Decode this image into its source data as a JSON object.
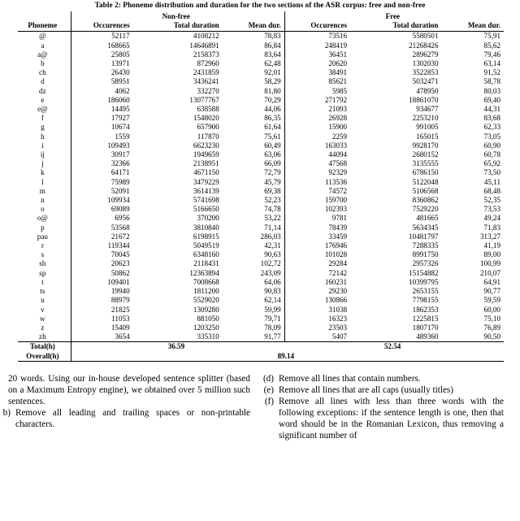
{
  "caption": "Table 2: Phoneme distribution and duration for the two sections of the ASR corpus: free and non-free",
  "table": {
    "group_headers": {
      "left": "Non-free",
      "right": "Free"
    },
    "columns": {
      "phoneme": "Phoneme",
      "occurences_nonfree": "Occurences",
      "total_duration_nonfree": "Total duration",
      "mean_dur_nonfree": "Mean dur.",
      "occurences_free": "Occurences",
      "total_duration_free": "Total duration",
      "mean_dur_free": "Mean dur."
    },
    "rows": [
      {
        "phoneme": "@",
        "nf_occ": "52117",
        "nf_tot": "4108212",
        "nf_mean": "78,83",
        "f_occ": "73516",
        "f_tot": "5580501",
        "f_mean": "75,91"
      },
      {
        "phoneme": "a",
        "nf_occ": "168665",
        "nf_tot": "14646891",
        "nf_mean": "86,84",
        "f_occ": "248419",
        "f_tot": "21268426",
        "f_mean": "85,62"
      },
      {
        "phoneme": "a@",
        "nf_occ": "25805",
        "nf_tot": "2158373",
        "nf_mean": "83,64",
        "f_occ": "36451",
        "f_tot": "2896279",
        "f_mean": "79,46"
      },
      {
        "phoneme": "b",
        "nf_occ": "13971",
        "nf_tot": "872960",
        "nf_mean": "62,48",
        "f_occ": "20620",
        "f_tot": "1302030",
        "f_mean": "63,14"
      },
      {
        "phoneme": "ch",
        "nf_occ": "26430",
        "nf_tot": "2431859",
        "nf_mean": "92,01",
        "f_occ": "38491",
        "f_tot": "3522853",
        "f_mean": "91,52"
      },
      {
        "phoneme": "d",
        "nf_occ": "58951",
        "nf_tot": "3436241",
        "nf_mean": "58,29",
        "f_occ": "85621",
        "f_tot": "5032471",
        "f_mean": "58,78"
      },
      {
        "phoneme": "dz",
        "nf_occ": "4062",
        "nf_tot": "332270",
        "nf_mean": "81,80",
        "f_occ": "5985",
        "f_tot": "478950",
        "f_mean": "80,03"
      },
      {
        "phoneme": "e",
        "nf_occ": "186060",
        "nf_tot": "13077767",
        "nf_mean": "70,29",
        "f_occ": "271792",
        "f_tot": "18861070",
        "f_mean": "69,40"
      },
      {
        "phoneme": "e@",
        "nf_occ": "14495",
        "nf_tot": "638588",
        "nf_mean": "44,06",
        "f_occ": "21093",
        "f_tot": "934677",
        "f_mean": "44,31"
      },
      {
        "phoneme": "f",
        "nf_occ": "17927",
        "nf_tot": "1548020",
        "nf_mean": "86,35",
        "f_occ": "26928",
        "f_tot": "2253210",
        "f_mean": "83,68"
      },
      {
        "phoneme": "g",
        "nf_occ": "10674",
        "nf_tot": "657900",
        "nf_mean": "61,64",
        "f_occ": "15900",
        "f_tot": "991005",
        "f_mean": "62,33"
      },
      {
        "phoneme": "h",
        "nf_occ": "1559",
        "nf_tot": "117870",
        "nf_mean": "75,61",
        "f_occ": "2259",
        "f_tot": "165015",
        "f_mean": "73,05"
      },
      {
        "phoneme": "i",
        "nf_occ": "109493",
        "nf_tot": "6623230",
        "nf_mean": "60,49",
        "f_occ": "163033",
        "f_tot": "9928170",
        "f_mean": "60,90"
      },
      {
        "phoneme": "ij",
        "nf_occ": "30917",
        "nf_tot": "1949659",
        "nf_mean": "63,06",
        "f_occ": "44094",
        "f_tot": "2680152",
        "f_mean": "60,78"
      },
      {
        "phoneme": "j",
        "nf_occ": "32366",
        "nf_tot": "2138951",
        "nf_mean": "66,09",
        "f_occ": "47568",
        "f_tot": "3135555",
        "f_mean": "65,92"
      },
      {
        "phoneme": "k",
        "nf_occ": "64171",
        "nf_tot": "4671150",
        "nf_mean": "72,79",
        "f_occ": "92329",
        "f_tot": "6786150",
        "f_mean": "73,50"
      },
      {
        "phoneme": "l",
        "nf_occ": "75989",
        "nf_tot": "3479229",
        "nf_mean": "45,79",
        "f_occ": "113536",
        "f_tot": "5122048",
        "f_mean": "45,11"
      },
      {
        "phoneme": "m",
        "nf_occ": "52091",
        "nf_tot": "3614139",
        "nf_mean": "69,38",
        "f_occ": "74572",
        "f_tot": "5106568",
        "f_mean": "68,48"
      },
      {
        "phoneme": "n",
        "nf_occ": "109934",
        "nf_tot": "5741698",
        "nf_mean": "52,23",
        "f_occ": "159700",
        "f_tot": "8360862",
        "f_mean": "52,35"
      },
      {
        "phoneme": "o",
        "nf_occ": "69089",
        "nf_tot": "5166650",
        "nf_mean": "74,78",
        "f_occ": "102393",
        "f_tot": "7529220",
        "f_mean": "73,53"
      },
      {
        "phoneme": "o@",
        "nf_occ": "6956",
        "nf_tot": "370200",
        "nf_mean": "53,22",
        "f_occ": "9781",
        "f_tot": "481665",
        "f_mean": "49,24"
      },
      {
        "phoneme": "p",
        "nf_occ": "53568",
        "nf_tot": "3810840",
        "nf_mean": "71,14",
        "f_occ": "78439",
        "f_tot": "5634345",
        "f_mean": "71,83"
      },
      {
        "phoneme": "pau",
        "nf_occ": "21672",
        "nf_tot": "6198915",
        "nf_mean": "286,03",
        "f_occ": "33459",
        "f_tot": "10481797",
        "f_mean": "313,27"
      },
      {
        "phoneme": "r",
        "nf_occ": "119344",
        "nf_tot": "5049519",
        "nf_mean": "42,31",
        "f_occ": "176946",
        "f_tot": "7288335",
        "f_mean": "41,19"
      },
      {
        "phoneme": "s",
        "nf_occ": "70045",
        "nf_tot": "6348160",
        "nf_mean": "90,63",
        "f_occ": "101028",
        "f_tot": "8991750",
        "f_mean": "89,00"
      },
      {
        "phoneme": "sh",
        "nf_occ": "20623",
        "nf_tot": "2118431",
        "nf_mean": "102,72",
        "f_occ": "29284",
        "f_tot": "2957326",
        "f_mean": "100,99"
      },
      {
        "phoneme": "sp",
        "nf_occ": "50862",
        "nf_tot": "12363894",
        "nf_mean": "243,09",
        "f_occ": "72142",
        "f_tot": "15154882",
        "f_mean": "210,07"
      },
      {
        "phoneme": "t",
        "nf_occ": "109401",
        "nf_tot": "7008668",
        "nf_mean": "64,06",
        "f_occ": "160231",
        "f_tot": "10399795",
        "f_mean": "64,91"
      },
      {
        "phoneme": "ts",
        "nf_occ": "19940",
        "nf_tot": "1811200",
        "nf_mean": "90,83",
        "f_occ": "29230",
        "f_tot": "2653155",
        "f_mean": "90,77"
      },
      {
        "phoneme": "u",
        "nf_occ": "88979",
        "nf_tot": "5529020",
        "nf_mean": "62,14",
        "f_occ": "130866",
        "f_tot": "7798155",
        "f_mean": "59,59"
      },
      {
        "phoneme": "v",
        "nf_occ": "21825",
        "nf_tot": "1309280",
        "nf_mean": "59,99",
        "f_occ": "31038",
        "f_tot": "1862353",
        "f_mean": "60,00"
      },
      {
        "phoneme": "w",
        "nf_occ": "11053",
        "nf_tot": "881050",
        "nf_mean": "79,71",
        "f_occ": "16323",
        "f_tot": "1225815",
        "f_mean": "75,10"
      },
      {
        "phoneme": "z",
        "nf_occ": "15409",
        "nf_tot": "1203250",
        "nf_mean": "78,09",
        "f_occ": "23503",
        "f_tot": "1807170",
        "f_mean": "76,89"
      },
      {
        "phoneme": "zh",
        "nf_occ": "3654",
        "nf_tot": "335310",
        "nf_mean": "91,77",
        "f_occ": "5407",
        "f_tot": "489360",
        "f_mean": "90,50"
      }
    ],
    "total": {
      "label": "Total(h)",
      "nonfree": "36.59",
      "free": "52.54"
    },
    "overall": {
      "label": "Overall(h)",
      "value": "89.14"
    }
  },
  "body": {
    "left": {
      "para": "20 words. Using our in-house developed sentence splitter (based on a Maximum Entropy engine), we obtained over 5 million such sentences.",
      "item_b": {
        "marker": "b)",
        "text": "Remove all leading and trailing spaces or non-printable characters."
      }
    },
    "right": {
      "item_d": {
        "marker": "(d)",
        "text": "Remove all lines that contain numbers."
      },
      "item_e": {
        "marker": "(e)",
        "text": "Remove all lines that are all caps (usually titles)"
      },
      "item_f": {
        "marker": "(f)",
        "text": "Remove all lines with less than three words with the following exceptions: if the sentence length is one, then that word should be in the Romanian Lexicon, thus removing a significant number of"
      }
    }
  }
}
